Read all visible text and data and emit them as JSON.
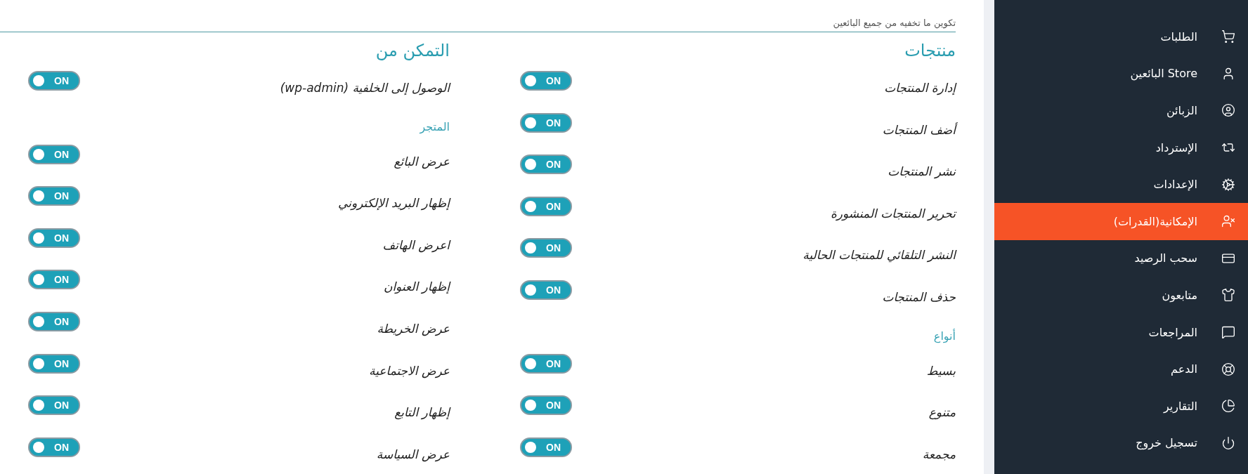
{
  "header": {
    "text": "تكوين ما تخفيه من جميع البائعين"
  },
  "columns": [
    {
      "title": "منتجات",
      "items": [
        {
          "kind": "toggle",
          "label": "إدارة المنتجات",
          "switch": "ON",
          "on": true
        },
        {
          "kind": "toggle",
          "label": "أضف المنتجات",
          "switch": "ON",
          "on": true
        },
        {
          "kind": "toggle",
          "label": "نشر المنتجات",
          "switch": "ON",
          "on": true
        },
        {
          "kind": "toggle",
          "label": "تحرير المنتجات المنشورة",
          "switch": "ON",
          "on": true
        },
        {
          "kind": "toggle",
          "label": "النشر التلقائي للمنتجات الحالية",
          "switch": "ON",
          "on": true
        },
        {
          "kind": "toggle",
          "label": "حذف المنتجات",
          "switch": "ON",
          "on": true
        },
        {
          "kind": "subheading",
          "label": "أنواع"
        },
        {
          "kind": "toggle",
          "label": "بسيط",
          "switch": "ON",
          "on": true
        },
        {
          "kind": "toggle",
          "label": "متنوع",
          "switch": "ON",
          "on": true
        },
        {
          "kind": "toggle",
          "label": "مجمعة",
          "switch": "ON",
          "on": true
        }
      ]
    },
    {
      "title": "التمكن من",
      "items": [
        {
          "kind": "toggle",
          "label": "الوصول إلى الخلفية (wp-admin)",
          "switch": "ON",
          "on": true
        },
        {
          "kind": "subheading",
          "label": "المتجر"
        },
        {
          "kind": "toggle",
          "label": "عرض البائع",
          "switch": "ON",
          "on": true
        },
        {
          "kind": "toggle",
          "label": "إظهار البريد الإلكتروني",
          "switch": "ON",
          "on": true
        },
        {
          "kind": "toggle",
          "label": "اعرض الهاتف",
          "switch": "ON",
          "on": true
        },
        {
          "kind": "toggle",
          "label": "إظهار العنوان",
          "switch": "ON",
          "on": true
        },
        {
          "kind": "toggle",
          "label": "عرض الخريطة",
          "switch": "ON",
          "on": true
        },
        {
          "kind": "toggle",
          "label": "عرض الاجتماعية",
          "switch": "ON",
          "on": true
        },
        {
          "kind": "toggle",
          "label": "إظهار التابع",
          "switch": "ON",
          "on": true
        },
        {
          "kind": "toggle",
          "label": "عرض السياسة",
          "switch": "ON",
          "on": true
        }
      ]
    }
  ],
  "sidebar": {
    "items": [
      {
        "label": "الطلبات",
        "selected": false
      },
      {
        "label": "Store البائعين",
        "selected": false
      },
      {
        "label": "الزبائن",
        "selected": false
      },
      {
        "label": "الإسترداد",
        "selected": false
      },
      {
        "label": "الإعدادات",
        "selected": false
      },
      {
        "label": "الإمكانية(القدرات)",
        "selected": true
      },
      {
        "label": "سحب الرصيد",
        "selected": false
      },
      {
        "label": "متابعون",
        "selected": false
      },
      {
        "label": "المراجعات",
        "selected": false
      },
      {
        "label": "الدعم",
        "selected": false
      },
      {
        "label": "التقارير",
        "selected": false
      },
      {
        "label": "تسجيل خروج",
        "selected": false
      }
    ]
  }
}
